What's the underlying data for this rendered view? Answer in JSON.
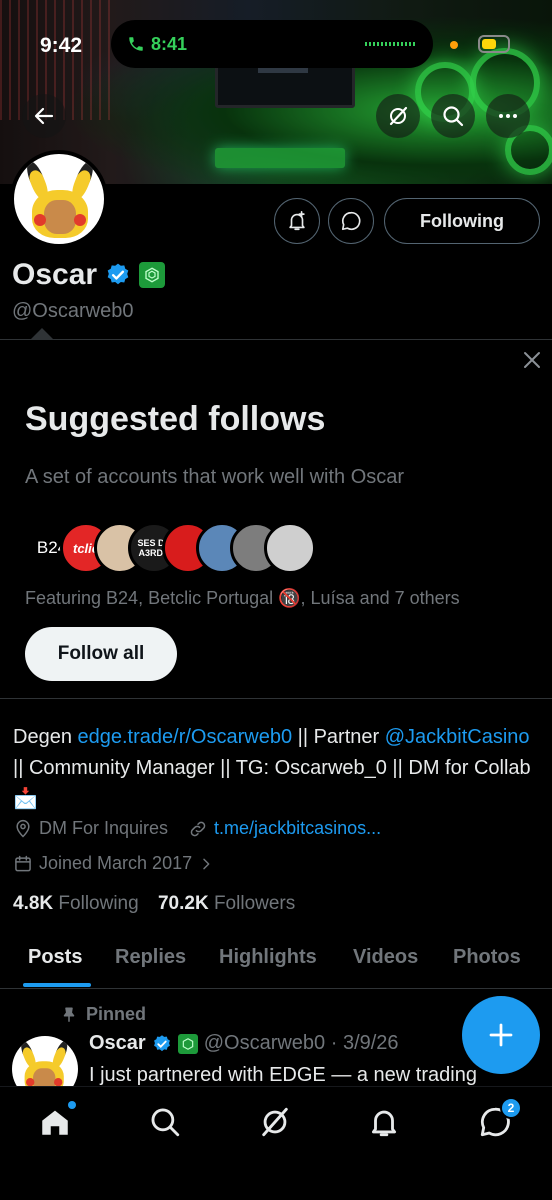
{
  "status_bar": {
    "time": "9:42",
    "call_time": "8:41"
  },
  "profile": {
    "name": "Oscar",
    "handle": "@Oscarweb0",
    "following_button": "Following"
  },
  "suggested": {
    "title": "Suggested follows",
    "subtitle": "A set of accounts that work well with Oscar",
    "avatars": [
      "B24",
      "tclic",
      "",
      "SES DE A3RDA",
      "",
      "",
      "",
      ""
    ],
    "featuring": "Featuring B24, Betclic Portugal 🔞, Luísa and 7 others",
    "follow_all": "Follow all"
  },
  "bio": {
    "t1": "Degen ",
    "link1": "edge.trade/r/Oscarweb0",
    "t2": " || Partner ",
    "link2": "@JackbitCasino",
    "t3": " || Community Manager || TG: Oscarweb_0 || DM for Collab📩",
    "location": "DM For Inquires",
    "website": "t.me/jackbitcasinos...",
    "joined": "Joined March 2017"
  },
  "stats": {
    "following_count": "4.8K",
    "following_label": "Following",
    "followers_count": "70.2K",
    "followers_label": "Followers"
  },
  "tabs": [
    "Posts",
    "Replies",
    "Highlights",
    "Videos",
    "Photos"
  ],
  "pinned_post": {
    "pinned_label": "Pinned",
    "name": "Oscar",
    "handle_date": "@Oscarweb0 · 3/9/26",
    "text": "I just partnered with EDGE — a new trading"
  },
  "bottom_nav": {
    "messages_badge": "2"
  },
  "colors": {
    "accent": "#1d9bf0",
    "background": "#000000",
    "muted": "#71767b"
  }
}
